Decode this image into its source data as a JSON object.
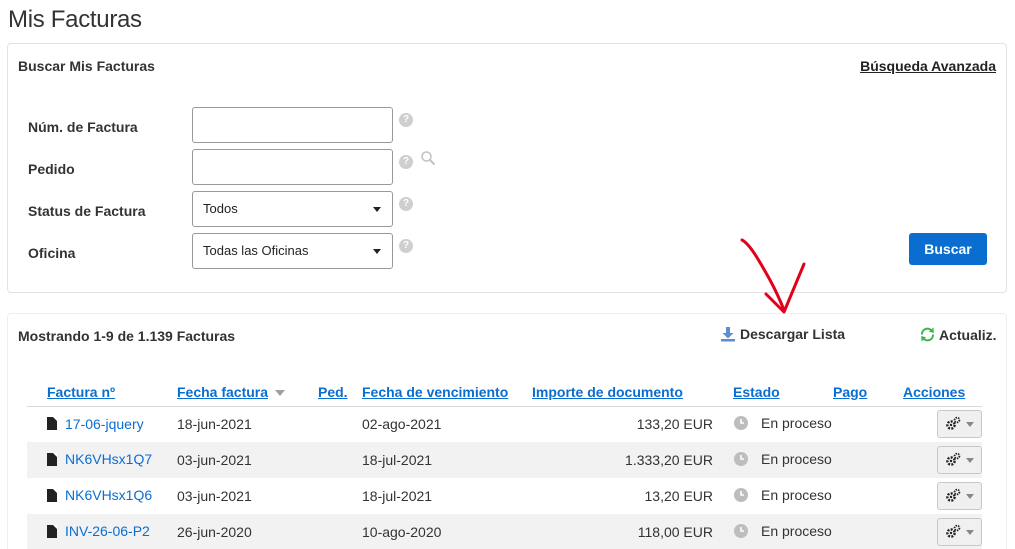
{
  "page": {
    "title": "Mis Facturas"
  },
  "search": {
    "title": "Buscar Mis Facturas",
    "advanced_link": "Búsqueda Avanzada",
    "fields": {
      "invoice_number": {
        "label": "Núm. de Factura",
        "value": ""
      },
      "order": {
        "label": "Pedido",
        "value": ""
      },
      "status": {
        "label": "Status de Factura",
        "selected": "Todos"
      },
      "office": {
        "label": "Oficina",
        "selected": "Todas las Oficinas"
      }
    },
    "submit_label": "Buscar"
  },
  "results": {
    "count_text": "Mostrando 1-9 de 1.139 Facturas",
    "download_label": "Descargar Lista",
    "refresh_label": "Actualiz.",
    "columns": {
      "number": "Factura nº",
      "date": "Fecha factura",
      "order": "Ped.",
      "due": "Fecha de vencimiento",
      "amount": "Importe de documento",
      "status": "Estado",
      "payment": "Pago",
      "actions": "Acciones"
    },
    "rows": [
      {
        "number": "17-06-jquery",
        "date": "18-jun-2021",
        "order": "",
        "due": "02-ago-2021",
        "amount": "133,20 EUR",
        "status": "En proceso",
        "payment": ""
      },
      {
        "number": "NK6VHsx1Q7",
        "date": "03-jun-2021",
        "order": "",
        "due": "18-jul-2021",
        "amount": "1.333,20 EUR",
        "status": "En proceso",
        "payment": ""
      },
      {
        "number": "NK6VHsx1Q6",
        "date": "03-jun-2021",
        "order": "",
        "due": "18-jul-2021",
        "amount": "13,20 EUR",
        "status": "En proceso",
        "payment": ""
      },
      {
        "number": "INV-26-06-P2",
        "date": "26-jun-2020",
        "order": "",
        "due": "10-ago-2020",
        "amount": "118,00 EUR",
        "status": "En proceso",
        "payment": ""
      }
    ]
  },
  "colors": {
    "primary": "#0a6ed1",
    "annotation_arrow": "#e3001b",
    "refresh_icon": "#3cb54a",
    "download_icon": "#5a8fd0"
  },
  "icons": {
    "help": "help-icon",
    "lookup": "search-icon",
    "download": "download-icon",
    "refresh": "refresh-icon",
    "document": "document-icon",
    "status": "clock-icon",
    "actions": "gear-icon"
  }
}
